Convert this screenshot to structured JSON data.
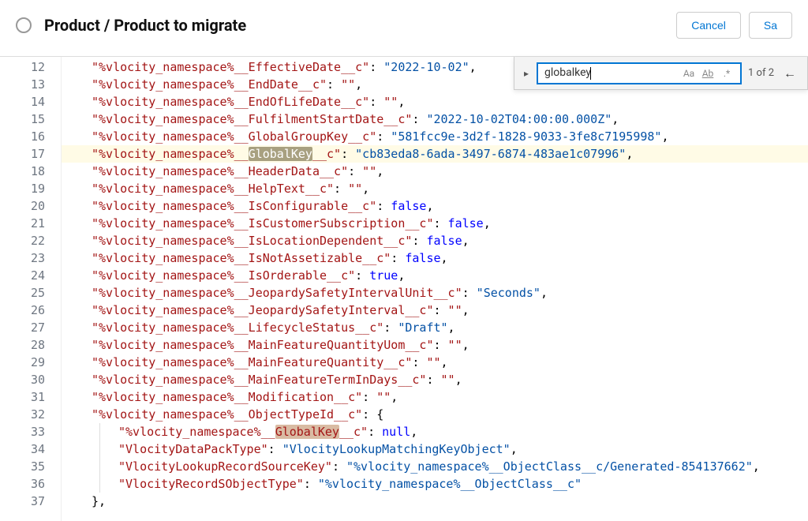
{
  "header": {
    "title": "Product / Product to migrate",
    "cancel": "Cancel",
    "save": "Sa"
  },
  "find": {
    "value": "globalkey",
    "count": "1 of 2",
    "case_icon": "Aa",
    "word_icon": "Ab",
    "regex_icon": ".*"
  },
  "lines": {
    "start": 12,
    "rows": [
      {
        "n": 12,
        "indent": 1,
        "key": "%vlocity_namespace%__EffectiveDate__c",
        "val": "\"2022-10-02\"",
        "vtype": "num-str"
      },
      {
        "n": 13,
        "indent": 1,
        "key": "%vlocity_namespace%__EndDate__c",
        "val": "\"\"",
        "vtype": "str"
      },
      {
        "n": 14,
        "indent": 1,
        "key": "%vlocity_namespace%__EndOfLifeDate__c",
        "val": "\"\"",
        "vtype": "str"
      },
      {
        "n": 15,
        "indent": 1,
        "key": "%vlocity_namespace%__FulfilmentStartDate__c",
        "val": "\"2022-10-02T04:00:00.000Z\"",
        "vtype": "num-str"
      },
      {
        "n": 16,
        "indent": 1,
        "key": "%vlocity_namespace%__GlobalGroupKey__c",
        "val": "\"581fcc9e-3d2f-1828-9033-3fe8c7195998\"",
        "vtype": "num-str"
      },
      {
        "n": 17,
        "indent": 1,
        "highlight": true,
        "keyPrefix": "%vlocity_namespace%__",
        "keyMatch": "GlobalKey",
        "matchClass": "current",
        "keySuffix": "__c",
        "val": "\"cb83eda8-6ada-3497-6874-483ae1c07996\"",
        "vtype": "num-str"
      },
      {
        "n": 18,
        "indent": 1,
        "key": "%vlocity_namespace%__HeaderData__c",
        "val": "\"\"",
        "vtype": "str"
      },
      {
        "n": 19,
        "indent": 1,
        "key": "%vlocity_namespace%__HelpText__c",
        "val": "\"\"",
        "vtype": "str"
      },
      {
        "n": 20,
        "indent": 1,
        "key": "%vlocity_namespace%__IsConfigurable__c",
        "val": "false",
        "vtype": "bool"
      },
      {
        "n": 21,
        "indent": 1,
        "key": "%vlocity_namespace%__IsCustomerSubscription__c",
        "val": "false",
        "vtype": "bool"
      },
      {
        "n": 22,
        "indent": 1,
        "key": "%vlocity_namespace%__IsLocationDependent__c",
        "val": "false",
        "vtype": "bool"
      },
      {
        "n": 23,
        "indent": 1,
        "key": "%vlocity_namespace%__IsNotAssetizable__c",
        "val": "false",
        "vtype": "bool"
      },
      {
        "n": 24,
        "indent": 1,
        "key": "%vlocity_namespace%__IsOrderable__c",
        "val": "true",
        "vtype": "bool"
      },
      {
        "n": 25,
        "indent": 1,
        "key": "%vlocity_namespace%__JeopardySafetyIntervalUnit__c",
        "val": "\"Seconds\"",
        "vtype": "num-str"
      },
      {
        "n": 26,
        "indent": 1,
        "key": "%vlocity_namespace%__JeopardySafetyInterval__c",
        "val": "\"\"",
        "vtype": "str"
      },
      {
        "n": 27,
        "indent": 1,
        "key": "%vlocity_namespace%__LifecycleStatus__c",
        "val": "\"Draft\"",
        "vtype": "num-str"
      },
      {
        "n": 28,
        "indent": 1,
        "key": "%vlocity_namespace%__MainFeatureQuantityUom__c",
        "val": "\"\"",
        "vtype": "str"
      },
      {
        "n": 29,
        "indent": 1,
        "key": "%vlocity_namespace%__MainFeatureQuantity__c",
        "val": "\"\"",
        "vtype": "str"
      },
      {
        "n": 30,
        "indent": 1,
        "key": "%vlocity_namespace%__MainFeatureTermInDays__c",
        "val": "\"\"",
        "vtype": "str"
      },
      {
        "n": 31,
        "indent": 1,
        "key": "%vlocity_namespace%__Modification__c",
        "val": "\"\"",
        "vtype": "str"
      },
      {
        "n": 32,
        "indent": 1,
        "key": "%vlocity_namespace%__ObjectTypeId__c",
        "valRaw": "{",
        "open": true
      },
      {
        "n": 33,
        "indent": 2,
        "keyPrefix": "%vlocity_namespace%__",
        "keyMatch": "GlobalKey",
        "matchClass": "",
        "keySuffix": "__c",
        "val": "null",
        "vtype": "null"
      },
      {
        "n": 34,
        "indent": 2,
        "key": "VlocityDataPackType",
        "val": "\"VlocityLookupMatchingKeyObject\"",
        "vtype": "num-str"
      },
      {
        "n": 35,
        "indent": 2,
        "key": "VlocityLookupRecordSourceKey",
        "val": "\"%vlocity_namespace%__ObjectClass__c/Generated-854137662\"",
        "vtype": "num-str"
      },
      {
        "n": 36,
        "indent": 2,
        "key": "VlocityRecordSObjectType",
        "val": "\"%vlocity_namespace%__ObjectClass__c\"",
        "vtype": "num-str",
        "last": true
      },
      {
        "n": 37,
        "indent": 1,
        "close": "},"
      }
    ]
  }
}
